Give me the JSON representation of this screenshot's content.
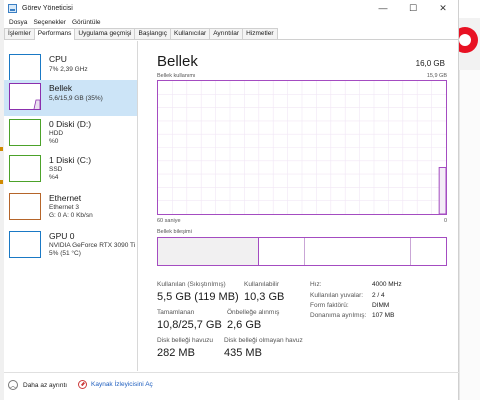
{
  "window": {
    "title": "Görev Yöneticisi",
    "controls": {
      "minimize": "—",
      "maximize": "☐",
      "close": "✕"
    }
  },
  "menu": [
    "Dosya",
    "Seçenekler",
    "Görüntüle"
  ],
  "tabs": [
    {
      "label": "İşlemler",
      "active": false
    },
    {
      "label": "Performans",
      "active": true
    },
    {
      "label": "Uygulama geçmişi",
      "active": false
    },
    {
      "label": "Başlangıç",
      "active": false
    },
    {
      "label": "Kullanıcılar",
      "active": false
    },
    {
      "label": "Ayrıntılar",
      "active": false
    },
    {
      "label": "Hizmetler",
      "active": false
    }
  ],
  "resources": [
    {
      "name": "CPU",
      "sub1": "7% 2,39 GHz",
      "sub2": "",
      "color": "#1a79c5",
      "selected": false
    },
    {
      "name": "Bellek",
      "sub1": "5,6/15,9 GB (35%)",
      "sub2": "",
      "color": "#8b2fad",
      "selected": true
    },
    {
      "name": "0 Diski (D:)",
      "sub1": "HDD",
      "sub2": "%0",
      "color": "#4ca22a",
      "selected": false
    },
    {
      "name": "1 Diski (C:)",
      "sub1": "SSD",
      "sub2": "%4",
      "color": "#4ca22a",
      "selected": false
    },
    {
      "name": "Ethernet",
      "sub1": "Ethernet 3",
      "sub2": "G: 0 A: 0 Kb/sn",
      "color": "#b5652a",
      "selected": false
    },
    {
      "name": "GPU 0",
      "sub1": "NVIDIA GeForce RTX 3090 Ti",
      "sub2": "5% (51 °C)",
      "color": "#1a79c5",
      "selected": false
    }
  ],
  "memory": {
    "title": "Bellek",
    "total": "16,0 GB",
    "usage_label": "Bellek kullanımı",
    "usage_max": "15,9 GB",
    "time_left": "60 saniye",
    "time_right": "0",
    "composition_label": "Bellek bileşimi",
    "usage_history_fraction": [
      0,
      0,
      0,
      0,
      0,
      0,
      0,
      0,
      0,
      0,
      0,
      0,
      0,
      0,
      0,
      0,
      0,
      0,
      0,
      0,
      0,
      0,
      0,
      0,
      0,
      0,
      0,
      0,
      0,
      0,
      0,
      0,
      0,
      0,
      0,
      0,
      0,
      0,
      0,
      0,
      0,
      0,
      0,
      0,
      0,
      0,
      0,
      0,
      0,
      0,
      0,
      0,
      0,
      0,
      0,
      0,
      0,
      0.35,
      0.35,
      0.35
    ],
    "stats": {
      "in_use_label": "Kullanılan (Sıkıştırılmış)",
      "in_use_value": "5,5 GB (119 MB)",
      "available_label": "Kullanılabilir",
      "available_value": "10,3 GB",
      "committed_label": "Tamamlanan",
      "committed_value": "10,8/25,7 GB",
      "cached_label": "Önbelleğe alınmış",
      "cached_value": "2,6 GB",
      "paged_label": "Disk belleği havuzu",
      "paged_value": "282 MB",
      "nonpaged_label": "Disk belleği olmayan havuz",
      "nonpaged_value": "435 MB"
    },
    "details": {
      "speed_label": "Hız:",
      "speed_value": "4000 MHz",
      "slots_label": "Kullanılan yuvalar:",
      "slots_value": "2 / 4",
      "form_label": "Form faktörü:",
      "form_value": "DIMM",
      "reserved_label": "Donanıma ayrılmış:",
      "reserved_value": "107 MB"
    }
  },
  "footer": {
    "fewer_details": "Daha az ayrıntı",
    "resource_monitor": "Kaynak İzleyicisini Aç"
  }
}
